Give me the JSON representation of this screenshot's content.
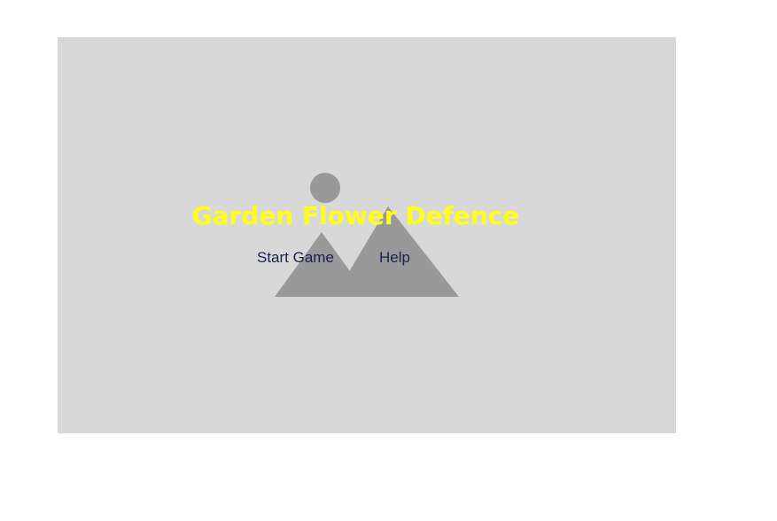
{
  "game": {
    "title": "Garden Flower Defence",
    "menu": {
      "start_label": "Start Game",
      "help_label": "Help"
    }
  },
  "background": {
    "icon": "image-placeholder-icon"
  },
  "colors": {
    "page_background": "#ffffff",
    "stage_background": "#d8d8d8",
    "placeholder_shape": "#999999",
    "title": "#ffff1a",
    "menu_text": "#1a1f4d"
  }
}
